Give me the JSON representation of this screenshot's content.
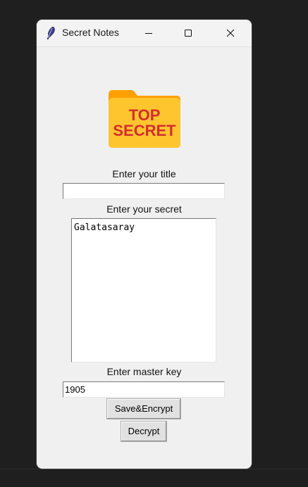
{
  "window": {
    "title": "Secret Notes"
  },
  "logo": {
    "line1": "TOP",
    "line2": "SECRET",
    "folder_color": "#FFC52E",
    "folder_back_color": "#FFA000",
    "text_color": "#D32F2F"
  },
  "form": {
    "title_label": "Enter your title",
    "title_value": "",
    "secret_label": "Enter your secret",
    "secret_value": "Galatasaray",
    "master_key_label": "Enter master key",
    "master_key_value": "1905",
    "save_button": "Save&Encrypt",
    "decrypt_button": "Decrypt"
  },
  "icons": {
    "app": "feather-icon",
    "minimize": "minimize-icon",
    "maximize": "maximize-icon",
    "close": "close-icon"
  }
}
